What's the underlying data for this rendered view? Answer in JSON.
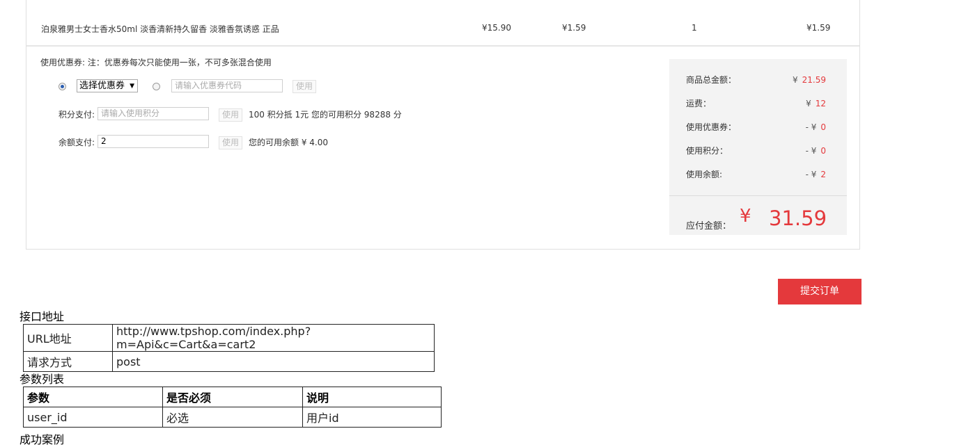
{
  "product": {
    "name": "泊泉雅男士女士香水50ml 淡香清新持久留香 淡雅香氛诱惑 正品",
    "market_price": "¥15.90",
    "member_price": "¥1.59",
    "quantity": "1",
    "subtotal": "¥1.59"
  },
  "coupon": {
    "note": "使用优惠券:  注：优惠券每次只能使用一张，不可多张混合使用",
    "select_label": "选择优惠券",
    "code_placeholder": "请输入优惠券代码",
    "use_label": "使用"
  },
  "points": {
    "label": "积分支付:",
    "placeholder": "请输入使用积分",
    "use_label": "使用",
    "info": "100 积分抵 1元     您的可用积分 98288 分"
  },
  "balance": {
    "label": "余额支付:",
    "value": "2",
    "use_label": "使用",
    "info": "您的可用余额 ¥ 4.00"
  },
  "summary": {
    "rows": [
      {
        "label": "商品总金额：",
        "prefix": "¥",
        "value": "21.59"
      },
      {
        "label": "运费：",
        "prefix": "¥",
        "value": "12"
      },
      {
        "label": "使用优惠券：",
        "prefix": "- ¥",
        "value": "0"
      },
      {
        "label": "使用积分：",
        "prefix": "- ¥",
        "value": "0"
      },
      {
        "label": "使用余额:",
        "prefix": "- ¥",
        "value": "2"
      }
    ],
    "pay_label": "应付金额：",
    "pay_currency": "¥",
    "pay_amount": "31.59"
  },
  "submit_label": "提交订单",
  "docs": {
    "interface_heading": "接口地址",
    "url_label": "URL地址",
    "url_value": "http://www.tpshop.com/index.php?m=Api&c=Cart&a=cart2",
    "method_label": "请求方式",
    "method_value": "post",
    "params_heading": "参数列表",
    "param_headers": [
      "参数",
      "是否必须",
      "说明"
    ],
    "params": [
      {
        "name": "user_id",
        "required": "必选",
        "desc": "用户id"
      }
    ],
    "next_heading": "成功案例"
  },
  "colors": {
    "accent": "#e4393c",
    "summary_bg": "#f3f3f3"
  }
}
